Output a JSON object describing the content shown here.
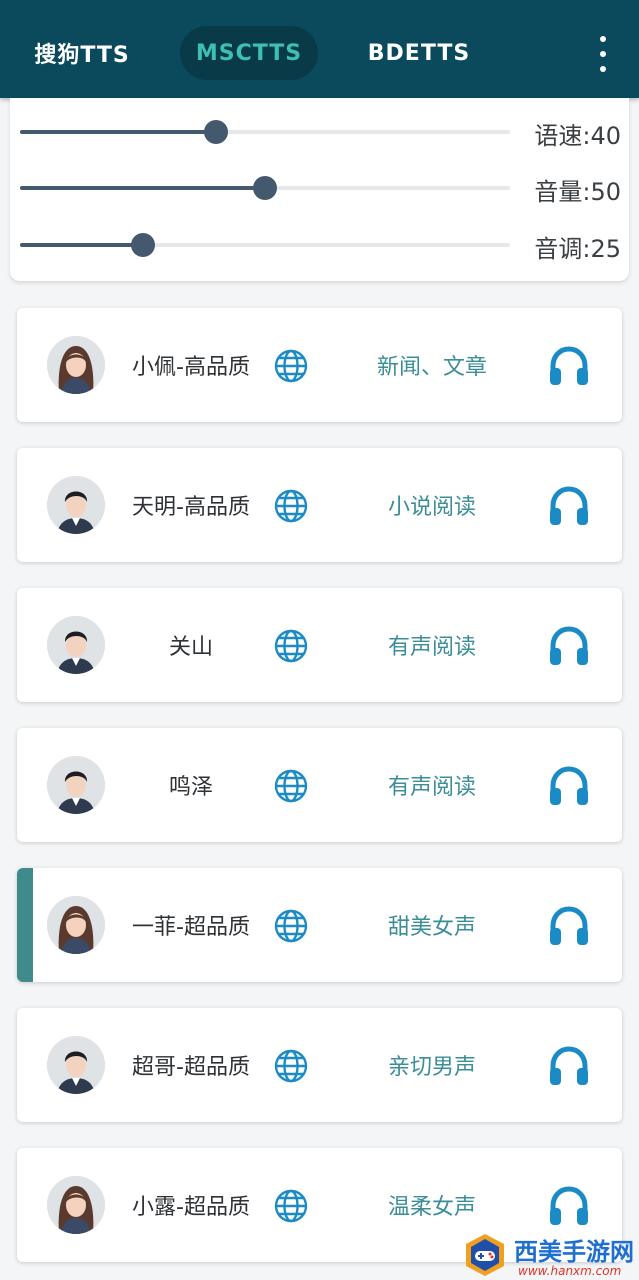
{
  "tabs": [
    {
      "label": "搜狗TTS",
      "active": false
    },
    {
      "label": "MSCTTS",
      "active": true
    },
    {
      "label": "BDETTS",
      "active": false
    }
  ],
  "menu_icon": "more-vert-icon",
  "sliders": [
    {
      "label": "语速:40",
      "value": 40,
      "max": 100
    },
    {
      "label": "音量:50",
      "value": 50,
      "max": 100
    },
    {
      "label": "音调:25",
      "value": 25,
      "max": 100
    }
  ],
  "voices": [
    {
      "name": "小佩-高品质",
      "desc": "新闻、文章",
      "selected": false,
      "avatar": "female"
    },
    {
      "name": "天明-高品质",
      "desc": "小说阅读",
      "selected": false,
      "avatar": "male"
    },
    {
      "name": "关山",
      "desc": "有声阅读",
      "selected": false,
      "avatar": "male"
    },
    {
      "name": "鸣泽",
      "desc": "有声阅读",
      "selected": false,
      "avatar": "male"
    },
    {
      "name": "一菲-超品质",
      "desc": "甜美女声",
      "selected": true,
      "avatar": "female"
    },
    {
      "name": "超哥-超品质",
      "desc": "亲切男声",
      "selected": false,
      "avatar": "male"
    },
    {
      "name": "小露-超品质",
      "desc": "温柔女声",
      "selected": false,
      "avatar": "female"
    }
  ],
  "watermark": {
    "title": "西美手游网",
    "url": "www.hanxm.com"
  },
  "colors": {
    "topbar": "#0b4a5c",
    "active_tab_text": "#3ec0b0",
    "slider": "#44596e",
    "accent": "#3f8a8a",
    "icon_blue": "#1b8bc6",
    "desc_text": "#3b8e98"
  }
}
